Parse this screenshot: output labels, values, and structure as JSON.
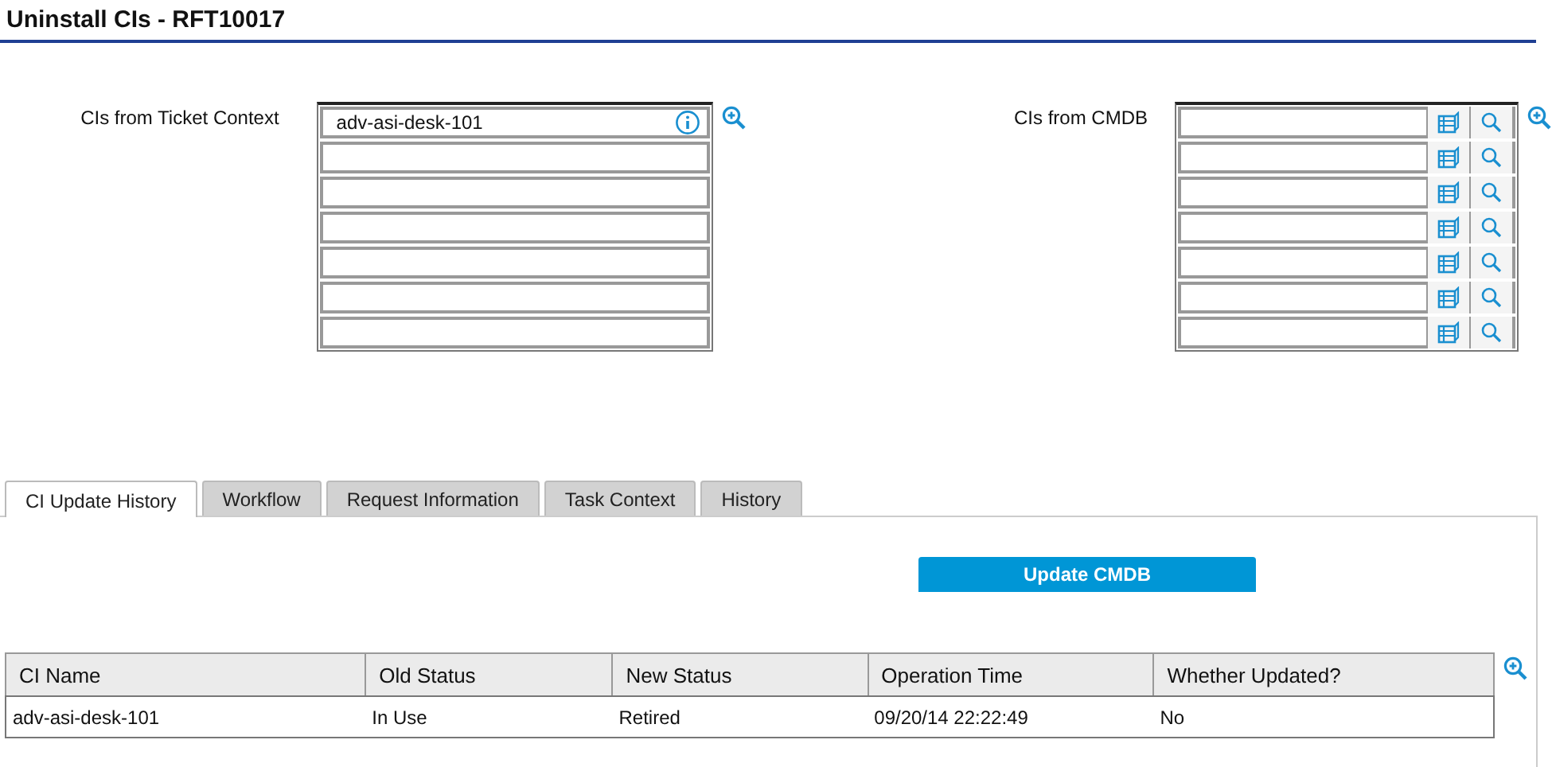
{
  "title": "Uninstall CIs - RFT10017",
  "ticket_context": {
    "label": "CIs from Ticket Context",
    "fields": [
      {
        "value": "adv-asi-desk-101",
        "info": true
      },
      {
        "info": false
      },
      {
        "info": false
      },
      {
        "info": false
      },
      {
        "info": false
      },
      {
        "info": false
      },
      {
        "info": false
      }
    ]
  },
  "cmdb": {
    "label": "CIs from CMDB",
    "fields": [
      {
        "kind": "lookup"
      },
      {
        "kind": "lookup"
      },
      {
        "kind": "lookup"
      },
      {
        "kind": "lookup"
      },
      {
        "kind": "lookup"
      },
      {
        "kind": "lookup"
      },
      {
        "kind": "lookup"
      }
    ]
  },
  "tabs": [
    {
      "label": "CI Update History",
      "selected": true
    },
    {
      "label": "Workflow",
      "selected": false
    },
    {
      "label": "Request Information",
      "selected": false
    },
    {
      "label": "Task Context",
      "selected": false
    },
    {
      "label": "History",
      "selected": false
    }
  ],
  "update_button": "Update CMDB",
  "table": {
    "columns": [
      "CI Name",
      "Old Status",
      "New Status",
      "Operation Time",
      "Whether Updated?"
    ],
    "rows": [
      [
        "adv-asi-desk-101",
        "In Use",
        "Retired",
        "09/20/14 22:22:49",
        "No"
      ]
    ]
  }
}
